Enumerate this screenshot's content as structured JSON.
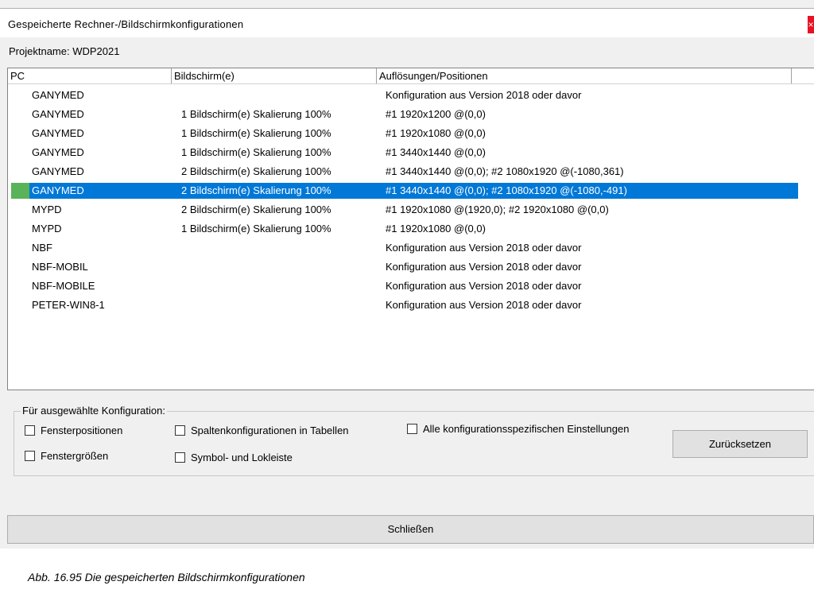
{
  "window": {
    "title": "Gespeicherte Rechner-/Bildschirmkonfigurationen",
    "close_label": "×"
  },
  "projekt": "Projektname: WDP2021",
  "table": {
    "columns": [
      "PC",
      "Bildschirm(e)",
      "Auflösungen/Positionen"
    ],
    "rows": [
      {
        "pc": "GANYMED",
        "bildschirme": "",
        "aufloesungen": "Konfiguration aus Version 2018 oder davor"
      },
      {
        "pc": "GANYMED",
        "bildschirme": "1 Bildschirm(e) Skalierung 100%",
        "aufloesungen": "#1 1920x1200 @(0,0)"
      },
      {
        "pc": "GANYMED",
        "bildschirme": "1 Bildschirm(e) Skalierung 100%",
        "aufloesungen": "#1 1920x1080 @(0,0)"
      },
      {
        "pc": "GANYMED",
        "bildschirme": "1 Bildschirm(e) Skalierung 100%",
        "aufloesungen": "#1 3440x1440 @(0,0)"
      },
      {
        "pc": "GANYMED",
        "bildschirme": "2 Bildschirm(e) Skalierung 100%",
        "aufloesungen": "#1 3440x1440 @(0,0); #2 1080x1920 @(-1080,361)"
      },
      {
        "pc": "GANYMED",
        "bildschirme": "2 Bildschirm(e) Skalierung 100%",
        "aufloesungen": "#1 3440x1440 @(0,0); #2 1080x1920 @(-1080,-491)",
        "selected": true
      },
      {
        "pc": "MYPD",
        "bildschirme": "2 Bildschirm(e) Skalierung 100%",
        "aufloesungen": "#1 1920x1080 @(1920,0); #2 1920x1080 @(0,0)"
      },
      {
        "pc": "MYPD",
        "bildschirme": "1 Bildschirm(e) Skalierung 100%",
        "aufloesungen": "#1 1920x1080 @(0,0)"
      },
      {
        "pc": "NBF",
        "bildschirme": "",
        "aufloesungen": "Konfiguration aus Version 2018 oder davor"
      },
      {
        "pc": "NBF-MOBIL",
        "bildschirme": "",
        "aufloesungen": "Konfiguration aus Version 2018 oder davor"
      },
      {
        "pc": "NBF-MOBILE",
        "bildschirme": "",
        "aufloesungen": "Konfiguration aus Version 2018 oder davor"
      },
      {
        "pc": "PETER-WIN8-1",
        "bildschirme": "",
        "aufloesungen": "Konfiguration aus Version 2018 oder davor"
      }
    ]
  },
  "group": {
    "label": "Für ausgewählte Konfiguration:",
    "checkboxes": {
      "fensterpositionen": {
        "label": "Fensterpositionen",
        "checked": false
      },
      "spaltenkonfigurationen": {
        "label": "Spaltenkonfigurationen in Tabellen",
        "checked": false
      },
      "alle": {
        "label": "Alle konfigurationsspezifischen Einstellungen",
        "checked": false
      },
      "fenstergroessen": {
        "label": "Fenstergrößen",
        "checked": false
      },
      "symbolleiste": {
        "label": "Symbol- und Lokleiste",
        "checked": false
      }
    },
    "reset_label": "Zurücksetzen"
  },
  "close_button_label": "Schließen",
  "caption": "Abb. 16.95  Die gespeicherten Bildschirmkonfigurationen",
  "colors": {
    "selection": "#0078d7",
    "marker": "#59b359",
    "close": "#e81123"
  }
}
